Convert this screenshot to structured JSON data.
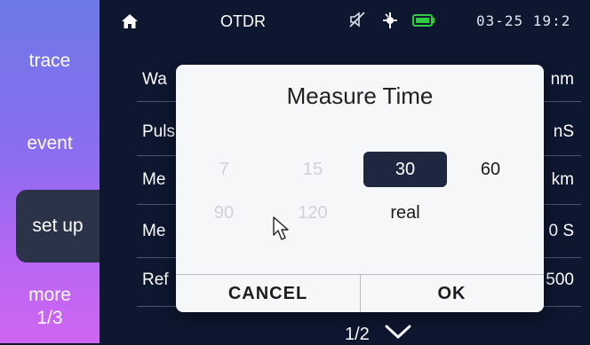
{
  "sidebar": {
    "items": [
      {
        "label": "trace"
      },
      {
        "label": "event"
      },
      {
        "label": "set up"
      },
      {
        "label": "more",
        "sub": "1/3"
      }
    ]
  },
  "statusbar": {
    "title": "OTDR",
    "clock": "03-25 19:2",
    "icons": [
      "home-icon",
      "mute-icon",
      "gps-icon",
      "battery-icon"
    ],
    "battery_color": "#2ecc40"
  },
  "list": {
    "rows": [
      {
        "label": "Wa",
        "unit": "nm"
      },
      {
        "label": "Puls",
        "unit": "nS"
      },
      {
        "label": "Me",
        "unit": "km"
      },
      {
        "label": "Me",
        "unit": "0 S"
      },
      {
        "label": "Ref",
        "unit": "500"
      }
    ],
    "pager": "1/2"
  },
  "dialog": {
    "title": "Measure Time",
    "options": [
      "7",
      "15",
      "30",
      "60",
      "90",
      "120",
      "real"
    ],
    "selected": "30",
    "cancel_label": "CANCEL",
    "ok_label": "OK"
  },
  "colors": {
    "background": "#0e1730",
    "sidebar_top": "#6d79e6",
    "sidebar_bottom": "#cf66f2",
    "selected_option": "#1d2840"
  }
}
